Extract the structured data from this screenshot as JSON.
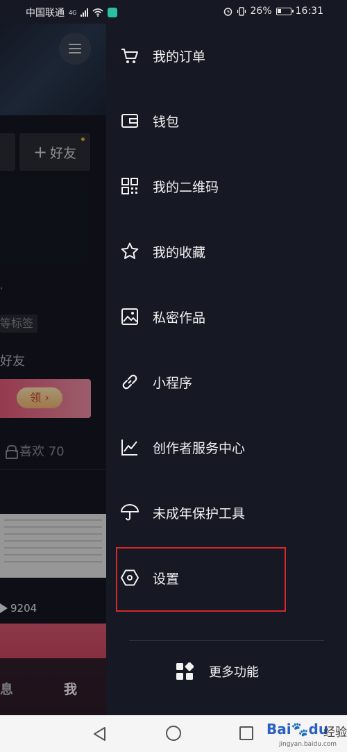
{
  "status_bar": {
    "carrier": "中国联通",
    "network": "4G",
    "battery_pct": "26%",
    "time": "16:31"
  },
  "background_profile": {
    "add_friend_label": "好友",
    "tag_text": "等标签",
    "friend_text": "好友",
    "banner_button": "领",
    "likes_label": "喜欢 70",
    "play_count": "9204",
    "nav_message": "息",
    "nav_me": "我"
  },
  "drawer": {
    "items": [
      {
        "label": "我的订单",
        "icon": "cart-icon"
      },
      {
        "label": "钱包",
        "icon": "wallet-icon"
      },
      {
        "label": "我的二维码",
        "icon": "qr-code-icon"
      },
      {
        "label": "我的收藏",
        "icon": "star-icon"
      },
      {
        "label": "私密作品",
        "icon": "private-image-icon"
      },
      {
        "label": "小程序",
        "icon": "link-icon"
      },
      {
        "label": "创作者服务中心",
        "icon": "chart-line-icon"
      },
      {
        "label": "未成年保护工具",
        "icon": "umbrella-icon"
      },
      {
        "label": "设置",
        "icon": "settings-hexagon-icon"
      }
    ],
    "more_label": "更多功能",
    "more_icon": "apps-grid-icon"
  },
  "annotation_color": "#d9262c",
  "watermark": {
    "logo": "Bai",
    "logo_suffix": "du",
    "cn": "经验",
    "url": "jingyan.baidu.com"
  }
}
